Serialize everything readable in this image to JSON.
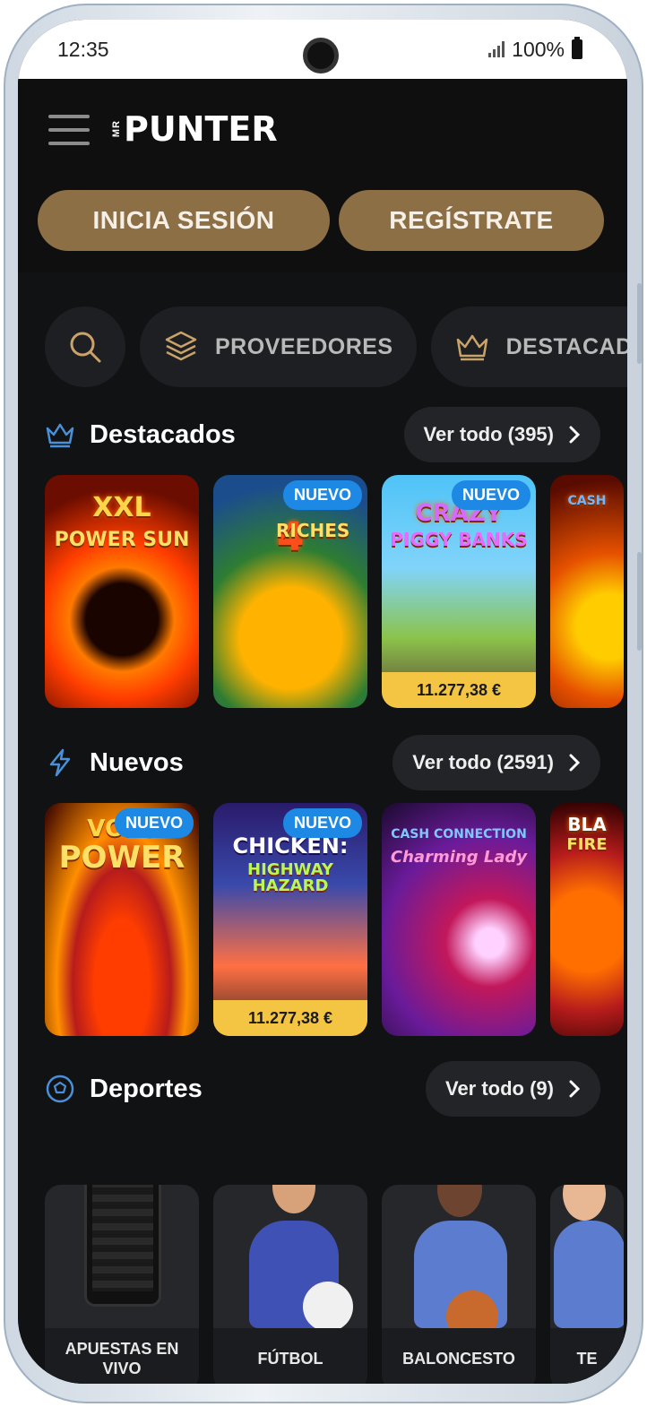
{
  "status_bar": {
    "time": "12:35",
    "battery": "100%"
  },
  "header": {
    "logo_mr": "MR",
    "logo_name": "PUNTER",
    "login_label": "INICIA SESIÓN",
    "register_label": "REGÍSTRATE"
  },
  "filters": {
    "providers_label": "PROVEEDORES",
    "featured_label": "DESTACADOS"
  },
  "sections": {
    "featured": {
      "title": "Destacados",
      "view_all": "Ver todo (395)",
      "cards": [
        {
          "title": "XXL",
          "subtitle": "POWER SUN",
          "badge": "",
          "price": ""
        },
        {
          "title": "4",
          "subtitle": "RICHES",
          "badge": "NUEVO",
          "price": ""
        },
        {
          "title": "CRAZY",
          "subtitle": "PIGGY BANKS",
          "badge": "NUEVO",
          "price": "11.277,38 €"
        },
        {
          "title": "CASH",
          "subtitle": "",
          "badge": "",
          "price": ""
        }
      ]
    },
    "new": {
      "title": "Nuevos",
      "view_all": "Ver todo (2591)",
      "cards": [
        {
          "title": "VOLC",
          "subtitle": "POWER",
          "badge": "NUEVO",
          "price": ""
        },
        {
          "title": "CHICKEN:",
          "subtitle": "HIGHWAY HAZARD",
          "badge": "NUEVO",
          "price": "11.277,38 €"
        },
        {
          "title": "CASH CONNECTION",
          "subtitle": "Charming Lady",
          "badge": "",
          "price": ""
        },
        {
          "title": "BLA",
          "subtitle": "FIRE",
          "badge": "",
          "price": ""
        }
      ]
    },
    "sports": {
      "title": "Deportes",
      "view_all": "Ver todo (9)",
      "cards": [
        {
          "label": "APUESTAS EN VIVO"
        },
        {
          "label": "FÚTBOL"
        },
        {
          "label": "BALONCESTO"
        },
        {
          "label": "TE"
        }
      ]
    }
  },
  "colors": {
    "accent_gold": "#8c6f45",
    "badge_blue": "#1e88e5",
    "price_yellow": "#f4c542",
    "icon_blue": "#4a90d9",
    "background": "#111214"
  }
}
